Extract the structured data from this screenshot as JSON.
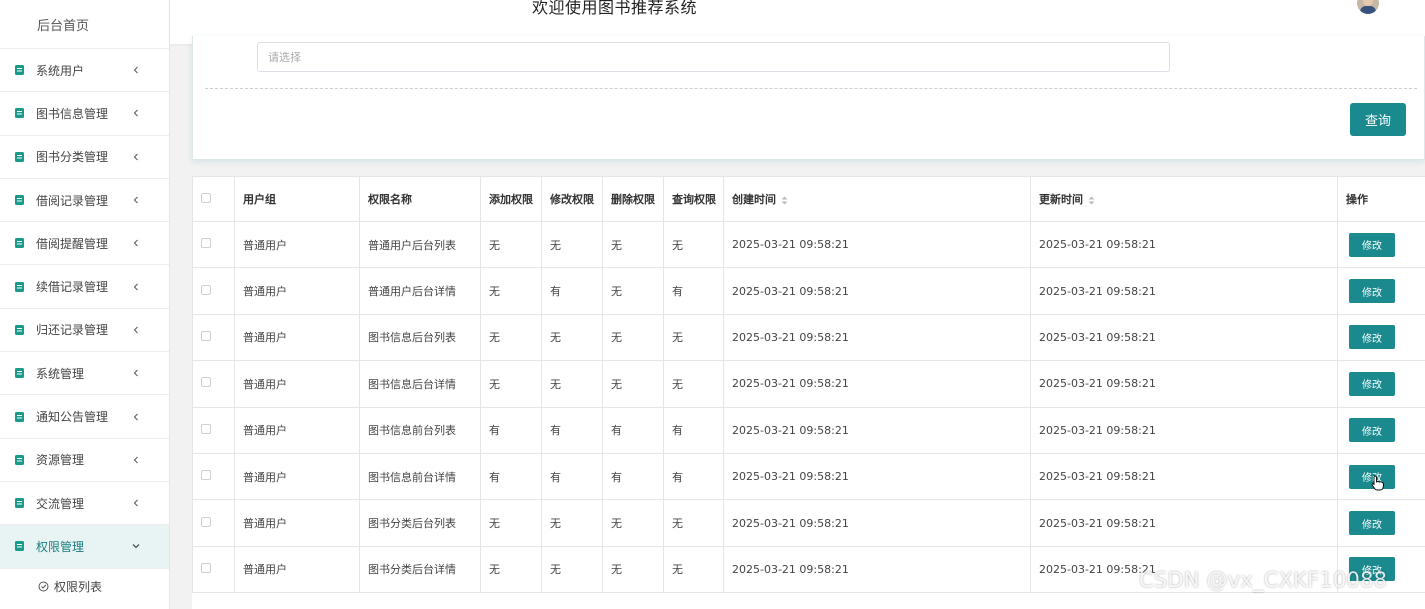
{
  "header": {
    "title": "欢迎使用图书推荐系统"
  },
  "sidebar": {
    "home": "后台首页",
    "items": [
      {
        "label": "系统用户"
      },
      {
        "label": "图书信息管理"
      },
      {
        "label": "图书分类管理"
      },
      {
        "label": "借阅记录管理"
      },
      {
        "label": "借阅提醒管理"
      },
      {
        "label": "续借记录管理"
      },
      {
        "label": "归还记录管理"
      },
      {
        "label": "系统管理"
      },
      {
        "label": "通知公告管理"
      },
      {
        "label": "资源管理"
      },
      {
        "label": "交流管理"
      },
      {
        "label": "权限管理",
        "active": true
      }
    ],
    "sub_item": "权限列表"
  },
  "search": {
    "select_placeholder": "请选择",
    "query_button": "查询"
  },
  "table": {
    "headers": {
      "group": "用户组",
      "name": "权限名称",
      "add": "添加权限",
      "modify": "修改权限",
      "delete": "删除权限",
      "query": "查询权限",
      "created": "创建时间",
      "updated": "更新时间",
      "action": "操作"
    },
    "edit_label": "修改",
    "rows": [
      {
        "group": "普通用户",
        "name": "普通用户后台列表",
        "add": "无",
        "modify": "无",
        "delete": "无",
        "query": "无",
        "created": "2025-03-21 09:58:21",
        "updated": "2025-03-21 09:58:21"
      },
      {
        "group": "普通用户",
        "name": "普通用户后台详情",
        "add": "无",
        "modify": "有",
        "delete": "无",
        "query": "有",
        "created": "2025-03-21 09:58:21",
        "updated": "2025-03-21 09:58:21"
      },
      {
        "group": "普通用户",
        "name": "图书信息后台列表",
        "add": "无",
        "modify": "无",
        "delete": "无",
        "query": "无",
        "created": "2025-03-21 09:58:21",
        "updated": "2025-03-21 09:58:21"
      },
      {
        "group": "普通用户",
        "name": "图书信息后台详情",
        "add": "无",
        "modify": "无",
        "delete": "无",
        "query": "无",
        "created": "2025-03-21 09:58:21",
        "updated": "2025-03-21 09:58:21"
      },
      {
        "group": "普通用户",
        "name": "图书信息前台列表",
        "add": "有",
        "modify": "有",
        "delete": "有",
        "query": "有",
        "created": "2025-03-21 09:58:21",
        "updated": "2025-03-21 09:58:21"
      },
      {
        "group": "普通用户",
        "name": "图书信息前台详情",
        "add": "有",
        "modify": "有",
        "delete": "有",
        "query": "有",
        "created": "2025-03-21 09:58:21",
        "updated": "2025-03-21 09:58:21"
      },
      {
        "group": "普通用户",
        "name": "图书分类后台列表",
        "add": "无",
        "modify": "无",
        "delete": "无",
        "query": "无",
        "created": "2025-03-21 09:58:21",
        "updated": "2025-03-21 09:58:21"
      },
      {
        "group": "普通用户",
        "name": "图书分类后台详情",
        "add": "无",
        "modify": "无",
        "delete": "无",
        "query": "无",
        "created": "2025-03-21 09:58:21",
        "updated": "2025-03-21 09:58:21"
      }
    ]
  },
  "watermark": "CSDN @vx_CXKF10088",
  "colors": {
    "accent": "#1a8a8f",
    "sidebar_active_bg": "#e8f4f3",
    "icon_green": "#1a9a8a"
  }
}
